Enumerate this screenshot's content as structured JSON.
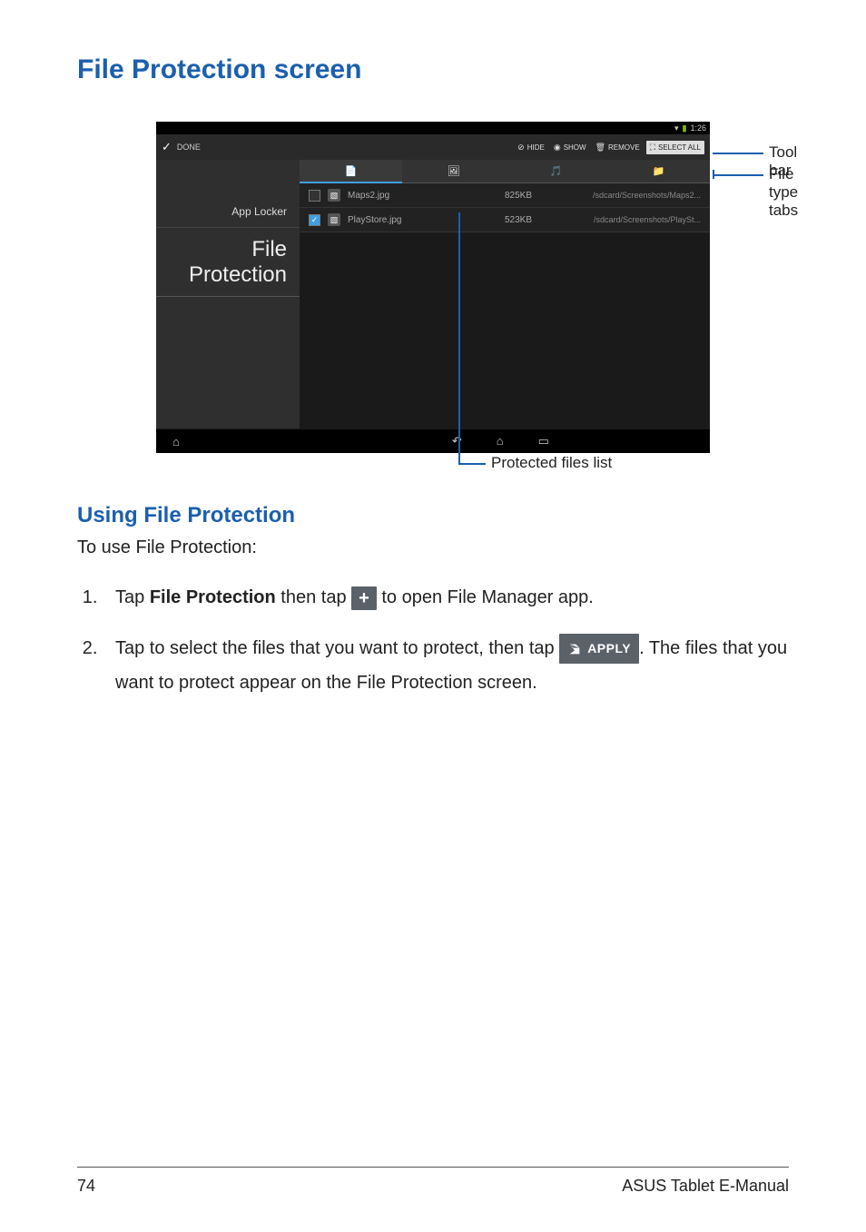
{
  "title": "File Protection screen",
  "screenshot": {
    "status": {
      "time": "1:26"
    },
    "titlebar": {
      "done": "DONE"
    },
    "toolbar": {
      "hide": "HIDE",
      "show": "SHOW",
      "remove": "REMOVE",
      "selectall": "SELECT ALL"
    },
    "sidebar": {
      "applocker": "App Locker",
      "fileprotection": "File Protection"
    },
    "tabs": {
      "t1": "",
      "t2": "",
      "t3": "",
      "t4": ""
    },
    "files": [
      {
        "name": "Maps2.jpg",
        "size": "825KB",
        "path": "/sdcard/Screenshots/Maps2..."
      },
      {
        "name": "PlayStore.jpg",
        "size": "523KB",
        "path": "/sdcard/Screenshots/PlaySt..."
      }
    ]
  },
  "annotations": {
    "toolbar": "Tool bar",
    "tabs": "File type tabs",
    "list": "Protected files list"
  },
  "subheading": "Using File Protection",
  "intro": "To use File Protection:",
  "steps": {
    "s1a": "Tap ",
    "s1b": "File Protection",
    "s1c": " then tap ",
    "s1d": " to open File Manager app.",
    "s2a": "Tap to select the files that you want to protect, then tap ",
    "s2b": ". The files that you want to protect appear on the File Protection screen.",
    "apply": "APPLY"
  },
  "footer": {
    "page": "74",
    "product": "ASUS Tablet E-Manual"
  }
}
